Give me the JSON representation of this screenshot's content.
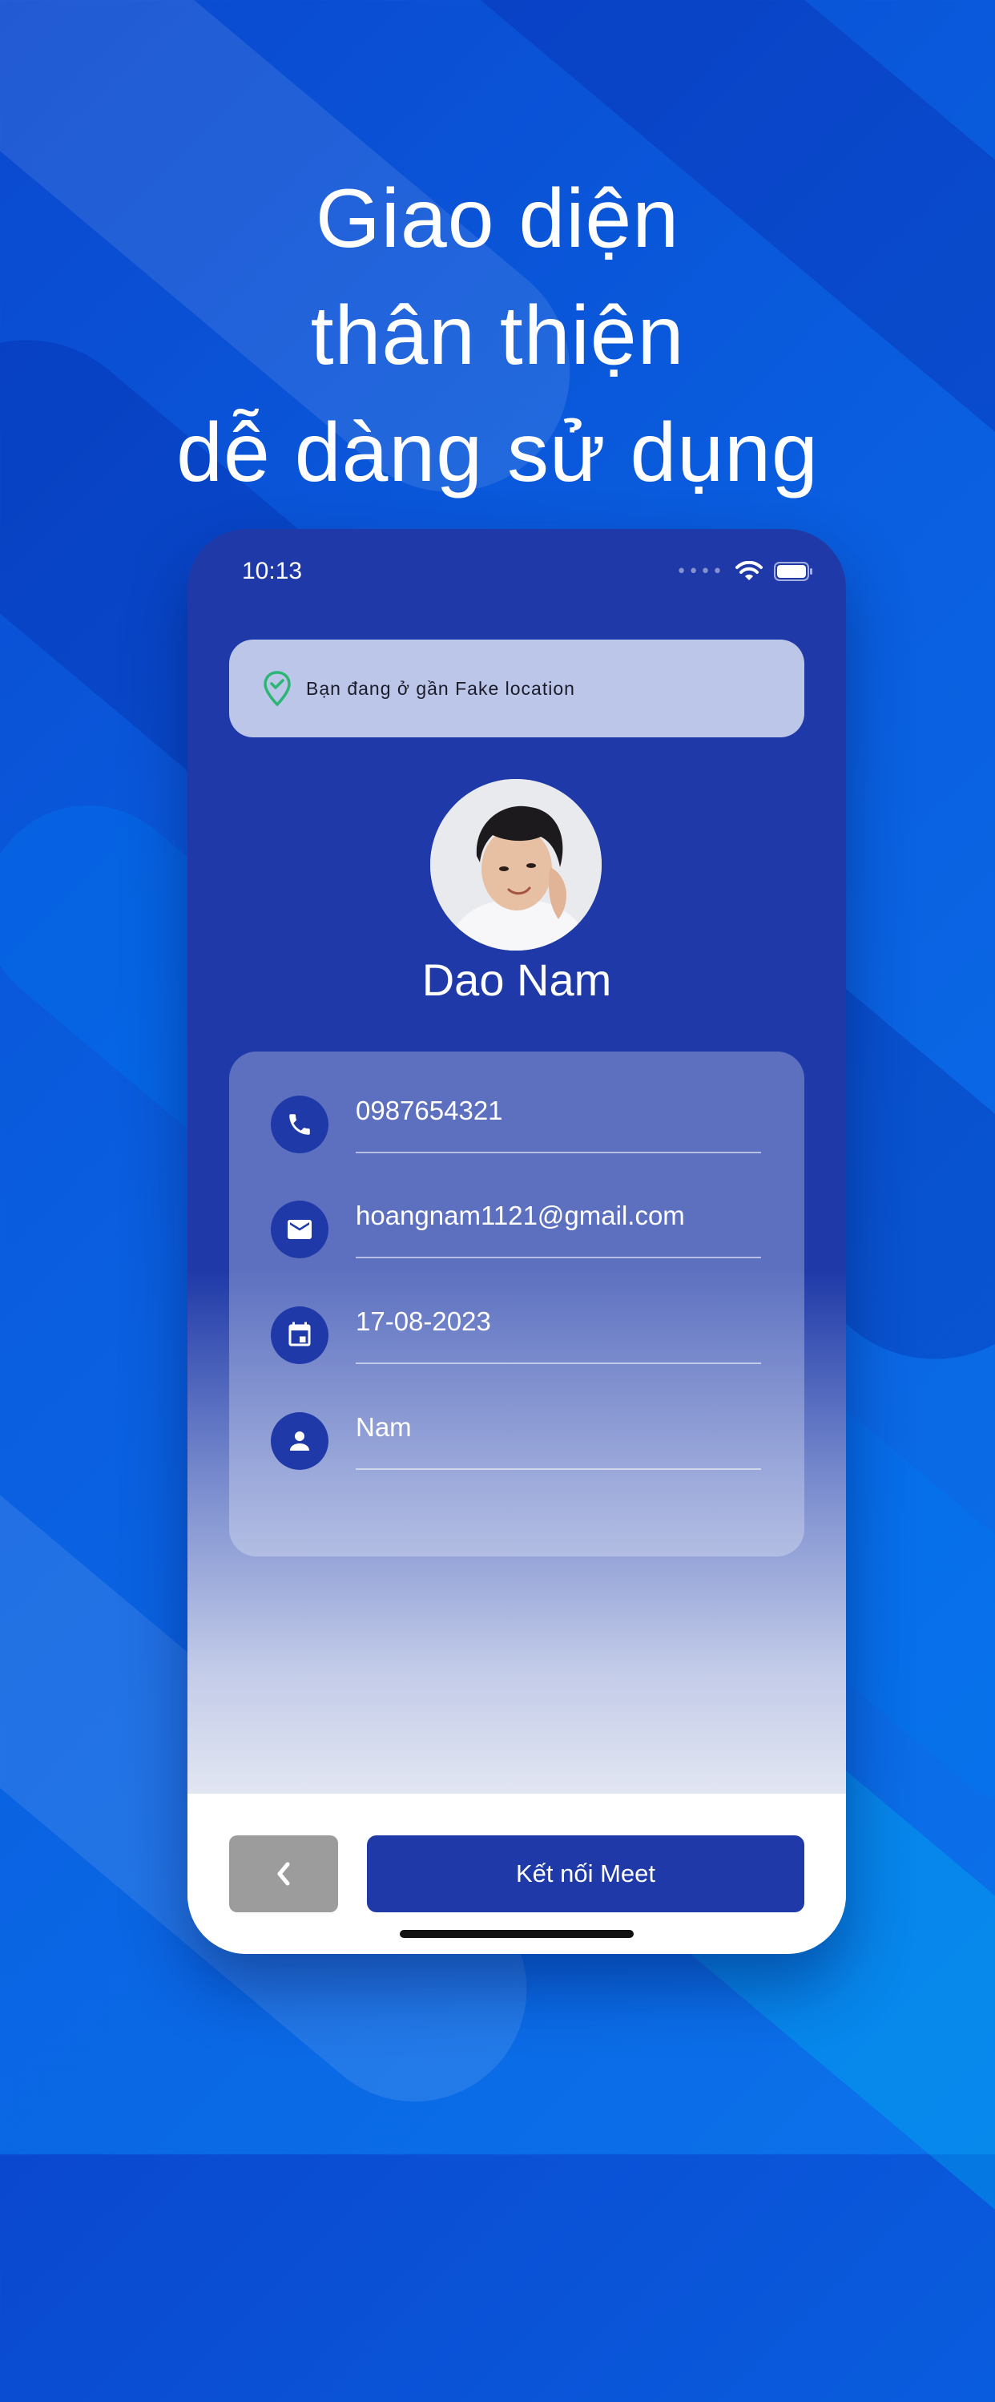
{
  "headline": {
    "line1": "Giao diện",
    "line2": "thân thiện",
    "line3": "dễ dàng sử dụng"
  },
  "status_bar": {
    "time": "10:13"
  },
  "location": {
    "text": "Bạn đang ở gần Fake location",
    "icon": "location-check-icon"
  },
  "profile": {
    "name": "Dao Nam"
  },
  "info": [
    {
      "icon": "phone-icon",
      "value": "0987654321"
    },
    {
      "icon": "email-icon",
      "value": "hoangnam1121@gmail.com"
    },
    {
      "icon": "calendar-icon",
      "value": "17-08-2023"
    },
    {
      "icon": "person-icon",
      "value": "Nam"
    }
  ],
  "actions": {
    "back_icon": "chevron-left-icon",
    "connect_label": "Kết nối Meet"
  },
  "colors": {
    "primary": "#1f3aa8",
    "background": "#0a5fe0",
    "back_button": "#9c9c9c",
    "location_pin": "#2bb673"
  }
}
